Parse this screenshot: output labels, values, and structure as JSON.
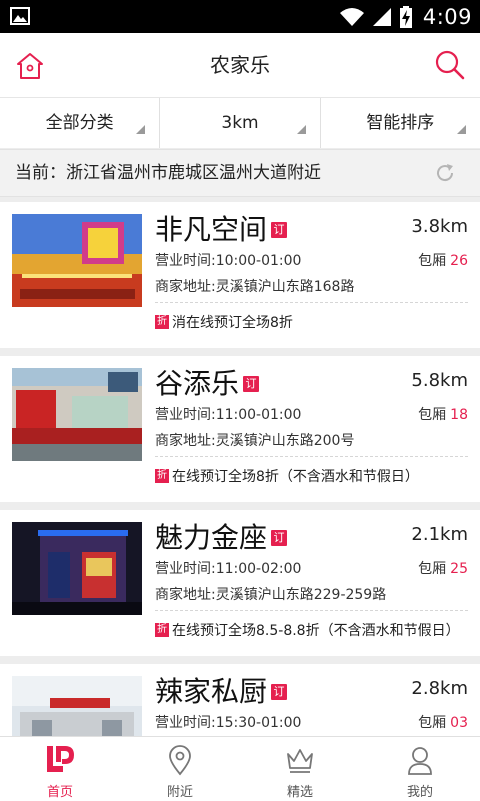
{
  "status_bar": {
    "time": "4:09"
  },
  "header": {
    "title": "农家乐"
  },
  "filters": [
    {
      "label": "全部分类"
    },
    {
      "label": "3km"
    },
    {
      "label": "智能排序"
    }
  ],
  "location": {
    "text": "当前：浙江省温州市鹿城区温州大道附近"
  },
  "badge_label": "订",
  "promo_badge_label": "折",
  "listings": [
    {
      "name": "非凡空间",
      "distance": "3.8km",
      "hours": "营业时间:10:00-01:00",
      "rooms_label": "包厢",
      "rooms_count": "26",
      "address": "商家地址:灵溪镇沪山东路168路",
      "promo": "消在线预订全场8折"
    },
    {
      "name": "谷添乐",
      "distance": "5.8km",
      "hours": "营业时间:11:00-01:00",
      "rooms_label": "包厢",
      "rooms_count": "18",
      "address": "商家地址:灵溪镇沪山东路200号",
      "promo": "在线预订全场8折（不含酒水和节假日）"
    },
    {
      "name": "魅力金座",
      "distance": "2.1km",
      "hours": "营业时间:11:00-02:00",
      "rooms_label": "包厢",
      "rooms_count": "25",
      "address": "商家地址:灵溪镇沪山东路229-259路",
      "promo": "在线预订全场8.5-8.8折（不含酒水和节假日）"
    },
    {
      "name": "辣家私厨",
      "distance": "2.8km",
      "hours": "营业时间:15:30-01:00",
      "rooms_label": "包厢",
      "rooms_count": "03",
      "address": "",
      "promo": ""
    }
  ],
  "tabs": [
    {
      "label": "首页",
      "icon": "home-logo-icon",
      "active": true
    },
    {
      "label": "附近",
      "icon": "location-pin-icon",
      "active": false
    },
    {
      "label": "精选",
      "icon": "crown-icon",
      "active": false
    },
    {
      "label": "我的",
      "icon": "user-icon",
      "active": false
    }
  ],
  "colors": {
    "accent": "#e5204f",
    "background": "#ededed"
  }
}
